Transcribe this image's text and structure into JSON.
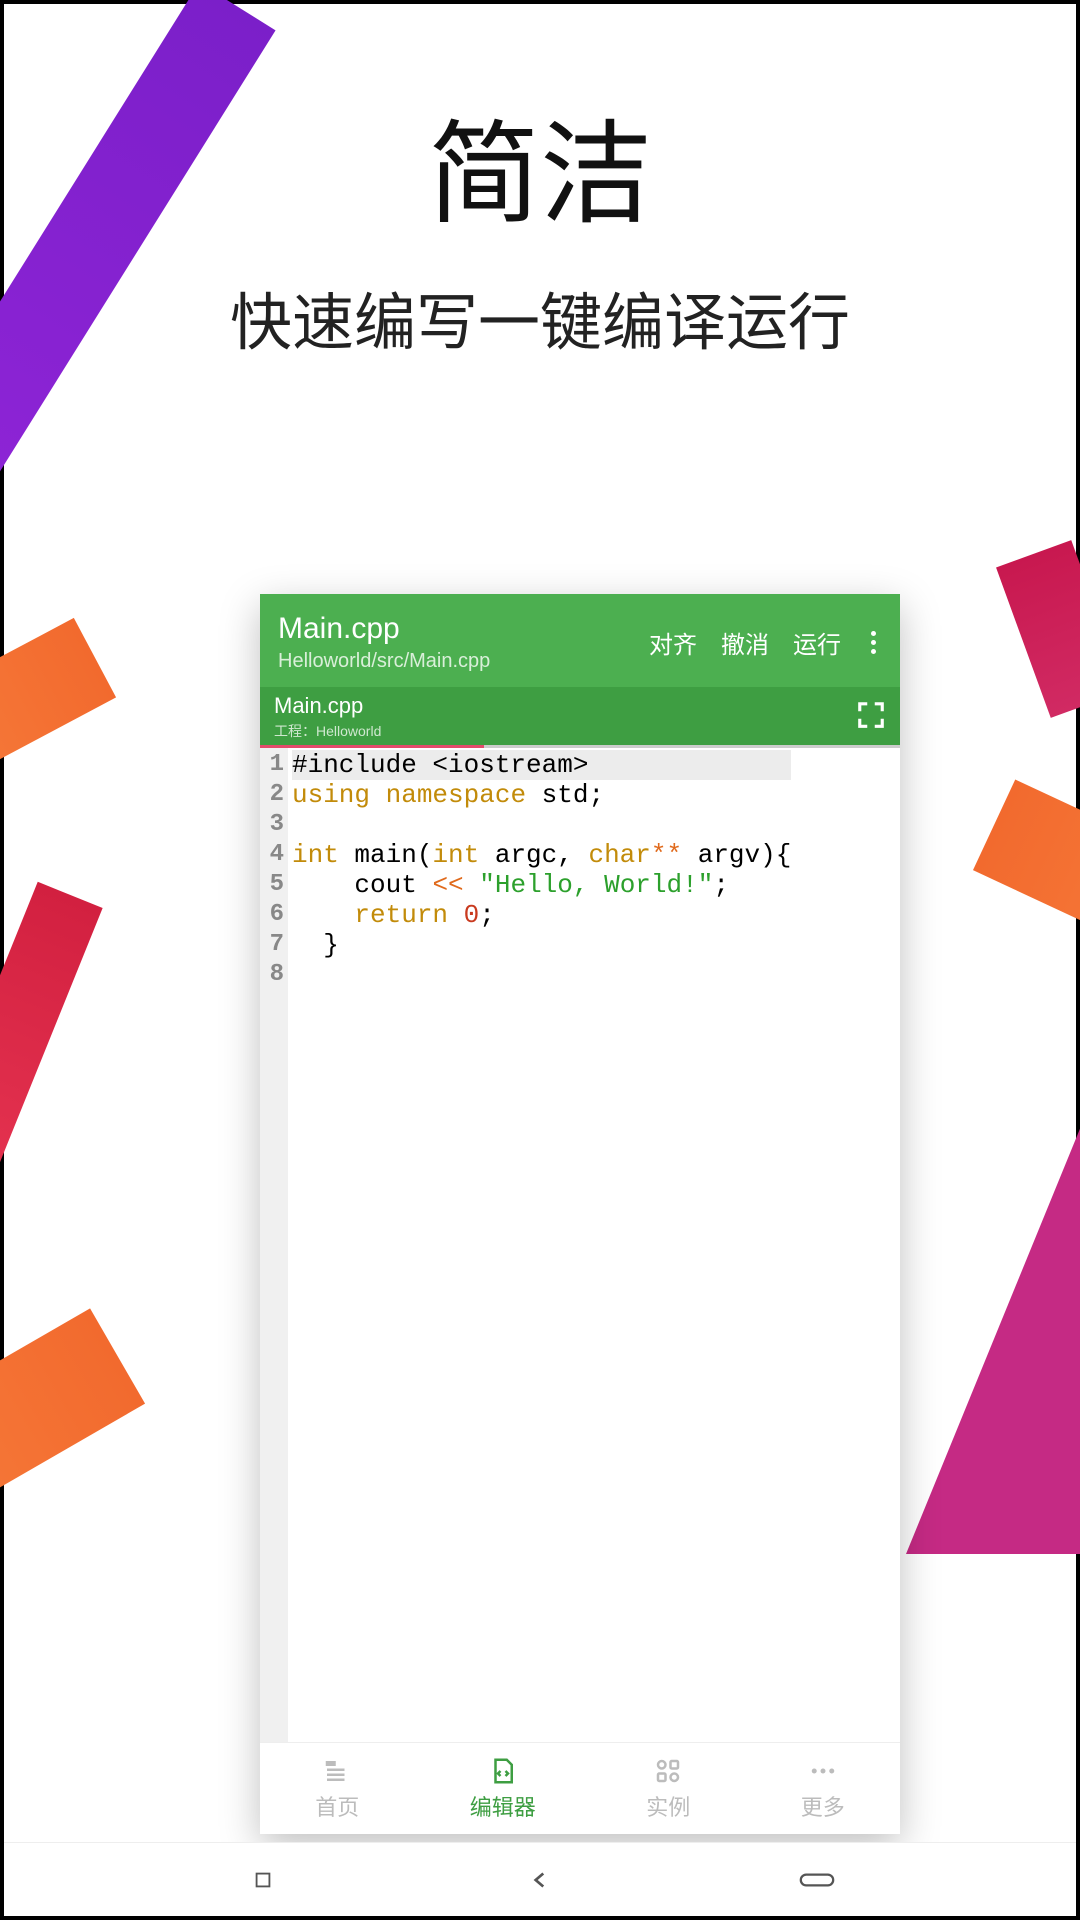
{
  "hero": {
    "title": "简洁",
    "subtitle": "快速编写一键编译运行"
  },
  "editor": {
    "filename": "Main.cpp",
    "path": "Helloworld/src/Main.cpp",
    "actions": {
      "align": "对齐",
      "undo": "撤消",
      "run": "运行"
    },
    "tab": {
      "name": "Main.cpp",
      "project": "工程：Helloworld"
    },
    "code": {
      "lines": [
        "1",
        "2",
        "3",
        "4",
        "5",
        "6",
        "7",
        "8"
      ],
      "l1_pre": "#include <iostream>",
      "l2_kw1": "using",
      "l2_kw2": "namespace",
      "l2_rest": " std;",
      "l4_kw": "int",
      "l4_name": " main(",
      "l4_t1": "int",
      "l4_a1": " argc, ",
      "l4_t2": "char",
      "l4_star": "**",
      "l4_a2": " argv){",
      "l5_indent": "    cout ",
      "l5_op": "<<",
      "l5_sp": " ",
      "l5_str": "\"Hello, World!\"",
      "l5_end": ";",
      "l6_indent": "    ",
      "l6_kw": "return",
      "l6_sp": " ",
      "l6_num": "0",
      "l6_end": ";",
      "l7": "  }"
    }
  },
  "nav": {
    "home": "首页",
    "editor": "编辑器",
    "examples": "实例",
    "more": "更多"
  }
}
